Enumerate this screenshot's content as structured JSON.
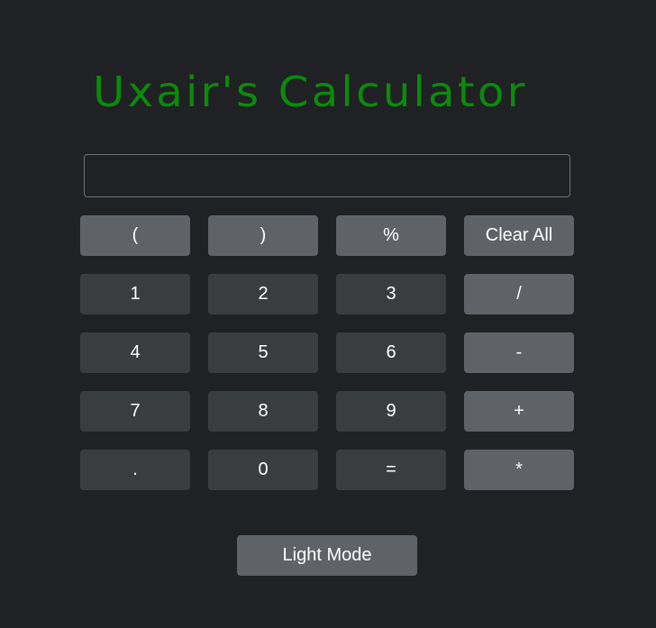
{
  "app": {
    "title": "Uxair's Calculator"
  },
  "display": {
    "value": ""
  },
  "keys": {
    "open_paren": "(",
    "close_paren": ")",
    "percent": "%",
    "clear_all": "Clear All",
    "one": "1",
    "two": "2",
    "three": "3",
    "divide": "/",
    "four": "4",
    "five": "5",
    "six": "6",
    "minus": "-",
    "seven": "7",
    "eight": "8",
    "nine": "9",
    "plus": "+",
    "decimal": ".",
    "zero": "0",
    "equals": "=",
    "multiply": "*"
  },
  "mode_toggle": {
    "label": "Light Mode"
  },
  "colors": {
    "background": "#202124",
    "title": "#0b8a0b",
    "number_key": "#3a3d40",
    "operator_key": "#5f6367",
    "text": "#ffffff"
  }
}
